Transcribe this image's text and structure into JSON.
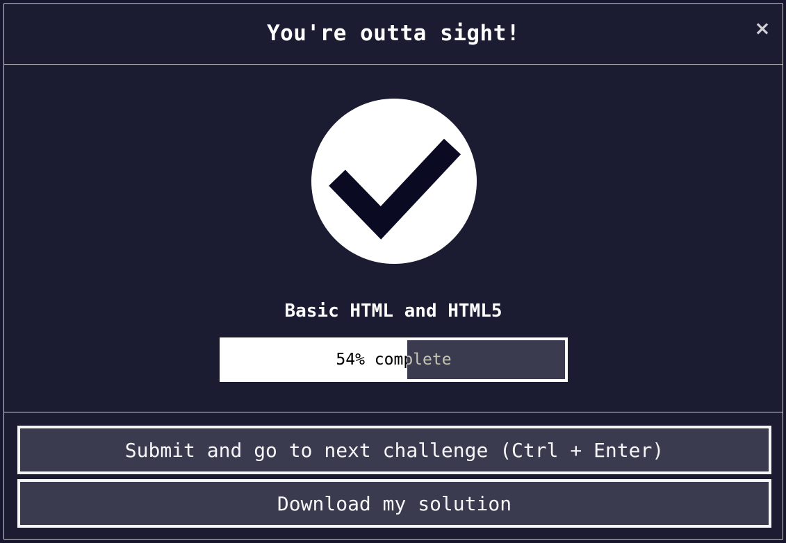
{
  "modal": {
    "title": "You're outta sight!",
    "close_label": "×"
  },
  "completion": {
    "block_title": "Basic HTML and HTML5",
    "progress_percent": 54,
    "progress_text": "54% complete"
  },
  "actions": {
    "submit_label": "Submit and go to next challenge (Ctrl + Enter)",
    "download_label": "Download my solution"
  },
  "colors": {
    "modal_background": "#1b1b32",
    "button_background": "#3b3b4f",
    "check_mark": "#0a0a23",
    "foreground": "#ffffff"
  },
  "icons": {
    "close": "close-icon",
    "success": "checkmark-circle-icon"
  }
}
